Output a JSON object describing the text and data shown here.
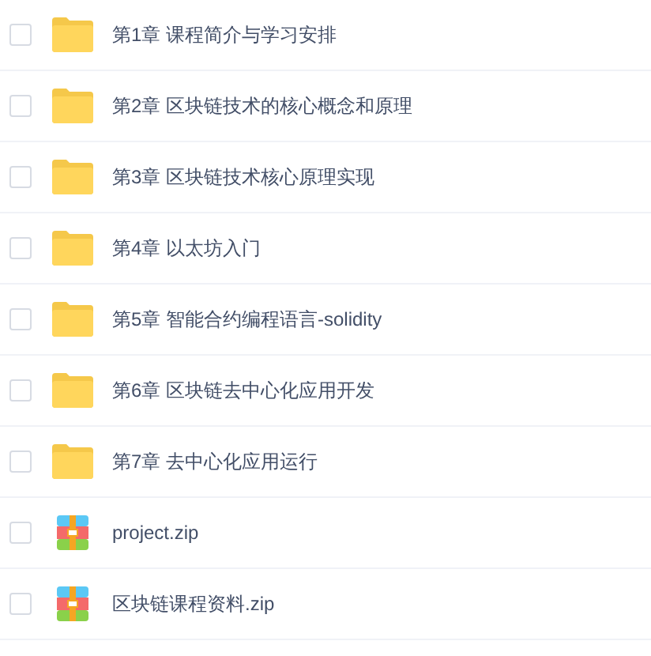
{
  "files": [
    {
      "name": "第1章 课程简介与学习安排",
      "kind": "folder",
      "checked": false
    },
    {
      "name": "第2章 区块链技术的核心概念和原理",
      "kind": "folder",
      "checked": false
    },
    {
      "name": "第3章 区块链技术核心原理实现",
      "kind": "folder",
      "checked": false
    },
    {
      "name": "第4章 以太坊入门",
      "kind": "folder",
      "checked": false
    },
    {
      "name": "第5章 智能合约编程语言-solidity",
      "kind": "folder",
      "checked": false
    },
    {
      "name": "第6章 区块链去中心化应用开发",
      "kind": "folder",
      "checked": false
    },
    {
      "name": "第7章 去中心化应用运行",
      "kind": "folder",
      "checked": false
    },
    {
      "name": "project.zip",
      "kind": "zip",
      "checked": false
    },
    {
      "name": "区块链课程资料.zip",
      "kind": "zip",
      "checked": false
    }
  ]
}
